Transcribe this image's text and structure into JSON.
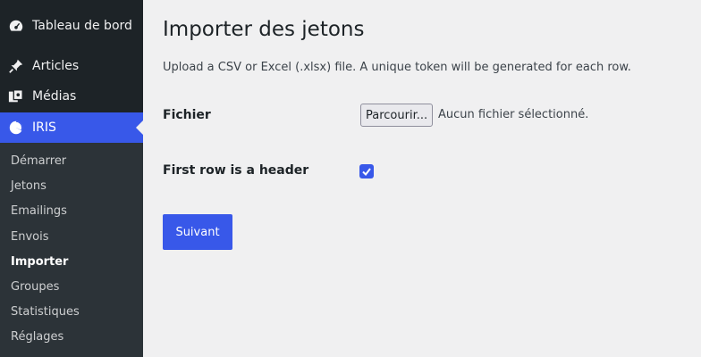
{
  "sidebar": {
    "top_items": [
      {
        "label": "Tableau de bord",
        "icon": "dashboard-icon"
      },
      {
        "label": "Articles",
        "icon": "pin-icon"
      },
      {
        "label": "Médias",
        "icon": "media-icon"
      },
      {
        "label": "IRIS",
        "icon": "pie-chart-icon",
        "active": true
      }
    ],
    "submenu": [
      {
        "label": "Démarrer"
      },
      {
        "label": "Jetons"
      },
      {
        "label": "Emailings"
      },
      {
        "label": "Envois"
      },
      {
        "label": "Importer",
        "current": true
      },
      {
        "label": "Groupes"
      },
      {
        "label": "Statistiques"
      },
      {
        "label": "Réglages"
      }
    ]
  },
  "main": {
    "title": "Importer des jetons",
    "description": "Upload a CSV or Excel (.xlsx) file. A unique token will be generated for each row.",
    "file_label": "Fichier",
    "file_button": "Parcourir...",
    "file_status": "Aucun fichier sélectionné.",
    "header_label": "First row is a header",
    "header_checked": true,
    "submit_label": "Suivant"
  },
  "colors": {
    "accent": "#3858e9",
    "sidebar_bg": "#1d2327",
    "submenu_bg": "#2c3338",
    "page_bg": "#f0f0f1"
  }
}
